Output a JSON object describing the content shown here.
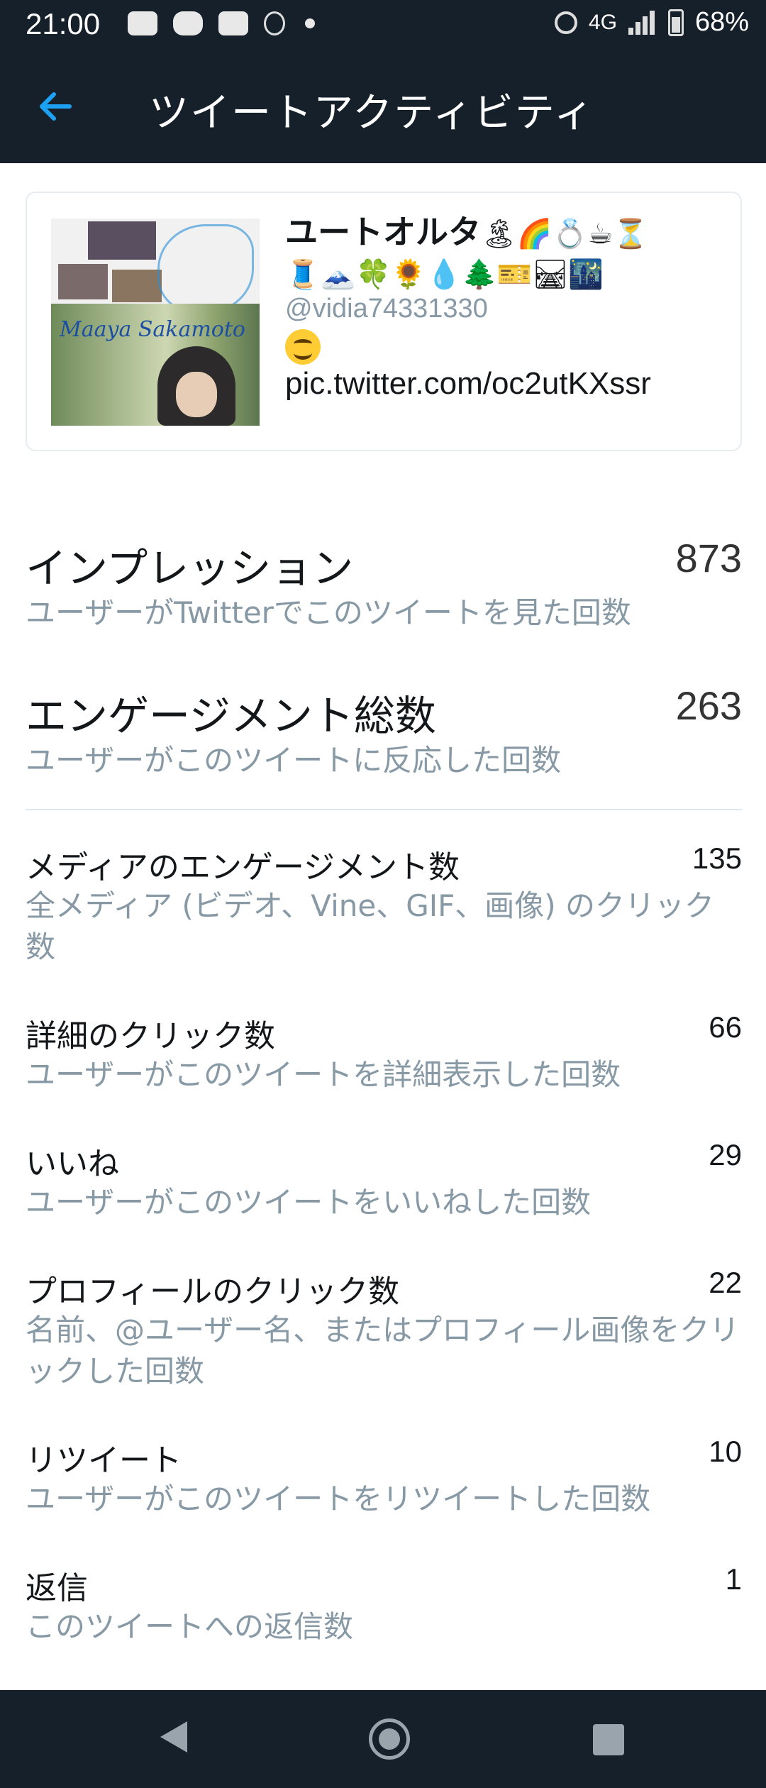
{
  "status_bar": {
    "time": "21:00",
    "network": "4G",
    "battery": "68%",
    "icons": [
      "youtube-icon",
      "line-icon",
      "tv-icon",
      "accessibility-icon",
      "dot-icon",
      "alarm-icon",
      "signal-icon",
      "battery-icon"
    ]
  },
  "app_bar": {
    "title": "ツイートアクティビティ",
    "back_icon": "arrow-left-icon",
    "accent": "#1da1f2"
  },
  "tweet": {
    "name": "ユートオルタ",
    "name_emoji_line1": "🏝🌈💍☕⏳",
    "name_emoji_line2": "🧵🗻🍀🌻💧🌲🎫🛤🌃",
    "handle": "@vidia74331330",
    "link": "pic.twitter.com/oc2utKXssr",
    "thumbnail_text": "Maaya Sakamoto"
  },
  "metrics_primary": [
    {
      "title": "インプレッション",
      "value": "873",
      "desc": "ユーザーがTwitterでこのツイートを見た回数"
    },
    {
      "title": "エンゲージメント総数",
      "value": "263",
      "desc": "ユーザーがこのツイートに反応した回数"
    }
  ],
  "metrics_detail": [
    {
      "title": "メディアのエンゲージメント数",
      "value": "135",
      "desc": "全メディア (ビデオ、Vine、GIF、画像) のクリック数"
    },
    {
      "title": "詳細のクリック数",
      "value": "66",
      "desc": "ユーザーがこのツイートを詳細表示した回数"
    },
    {
      "title": "いいね",
      "value": "29",
      "desc": "ユーザーがこのツイートをいいねした回数"
    },
    {
      "title": "プロフィールのクリック数",
      "value": "22",
      "desc": "名前、@ユーザー名、またはプロフィール画像をクリックした回数"
    },
    {
      "title": "リツイート",
      "value": "10",
      "desc": "ユーザーがこのツイートをリツイートした回数"
    },
    {
      "title": "返信",
      "value": "1",
      "desc": "このツイートへの返信数"
    }
  ],
  "colors": {
    "header_bg": "#15202b",
    "secondary_text": "#8899a6",
    "divider": "#e1e8ed"
  }
}
